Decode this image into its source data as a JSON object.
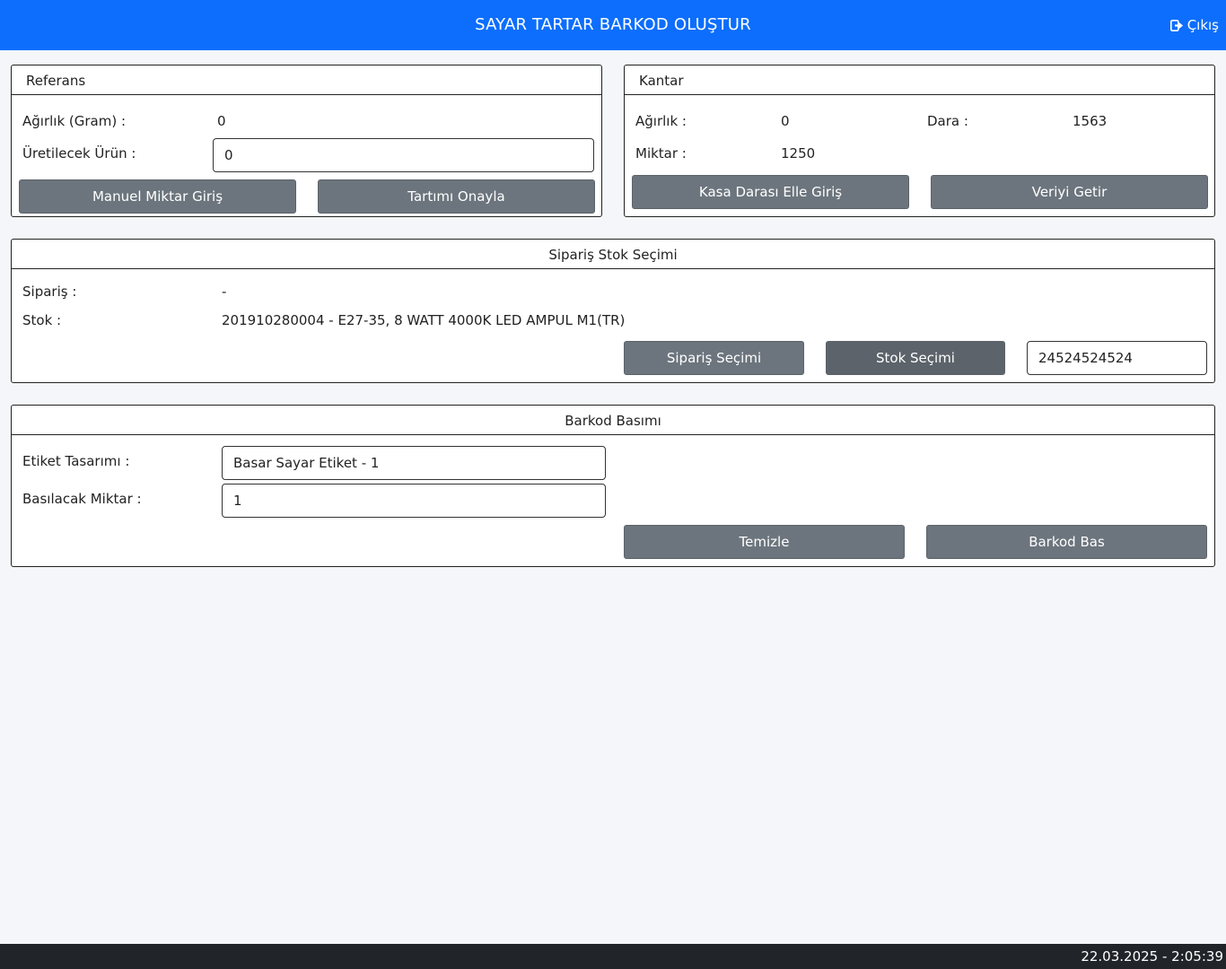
{
  "header": {
    "title": "SAYAR TARTAR BARKOD OLUŞTUR",
    "logout_label": "Çıkış",
    "logout_icon": "sign-out-icon",
    "color": "#0d6efd"
  },
  "referans": {
    "title": "Referans",
    "weight_label": "Ağırlık (Gram) :",
    "weight_value": "0",
    "product_label": "Üretilecek Ürün :",
    "product_value": "0",
    "manual_button": "Manuel Miktar Giriş",
    "confirm_button": "Tartımı Onayla"
  },
  "kantar": {
    "title": "Kantar",
    "weight_label": "Ağırlık :",
    "weight_value": "0",
    "tare_label": "Dara :",
    "tare_value": "1563",
    "quantity_label": "Miktar :",
    "quantity_value": "1250",
    "tare_manual_button": "Kasa Darası Elle Giriş",
    "fetch_button": "Veriyi Getir"
  },
  "siparis": {
    "title": "Sipariş Stok Seçimi",
    "order_label": "Sipariş :",
    "order_value": "-",
    "stock_label": "Stok :",
    "stock_value": "201910280004 - E27-35, 8 WATT 4000K LED AMPUL M1(TR)",
    "order_button": "Sipariş Seçimi",
    "stock_button": "Stok Seçimi",
    "code_value": "24524524524"
  },
  "barkod": {
    "title": "Barkod Basımı",
    "design_label": "Etiket Tasarımı :",
    "design_value": "Basar Sayar Etiket - 1",
    "qty_label": "Basılacak Miktar :",
    "qty_value": "1",
    "clear_button": "Temizle",
    "print_button": "Barkod Bas"
  },
  "footer": {
    "datetime": "22.03.2025 - 2:05:39"
  }
}
